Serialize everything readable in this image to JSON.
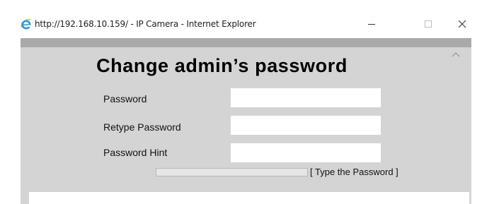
{
  "window": {
    "title": "http://192.168.10.159/ - IP Camera - Internet Explorer",
    "icon": "internet-explorer-icon"
  },
  "page": {
    "heading": "Change admin’s password"
  },
  "form": {
    "password_label": "Password",
    "password_value": "",
    "retype_label": "Retype Password",
    "retype_value": "",
    "hint_label": "Password Hint",
    "hint_value": "",
    "strength_text": "[ Type the Password ]",
    "strength_level": 0
  },
  "colors": {
    "content_bg": "#d4d4d4",
    "top_strip": "#a9a9a9",
    "ie_blue": "#1ea0e6",
    "ie_gold": "#f2b61b"
  }
}
